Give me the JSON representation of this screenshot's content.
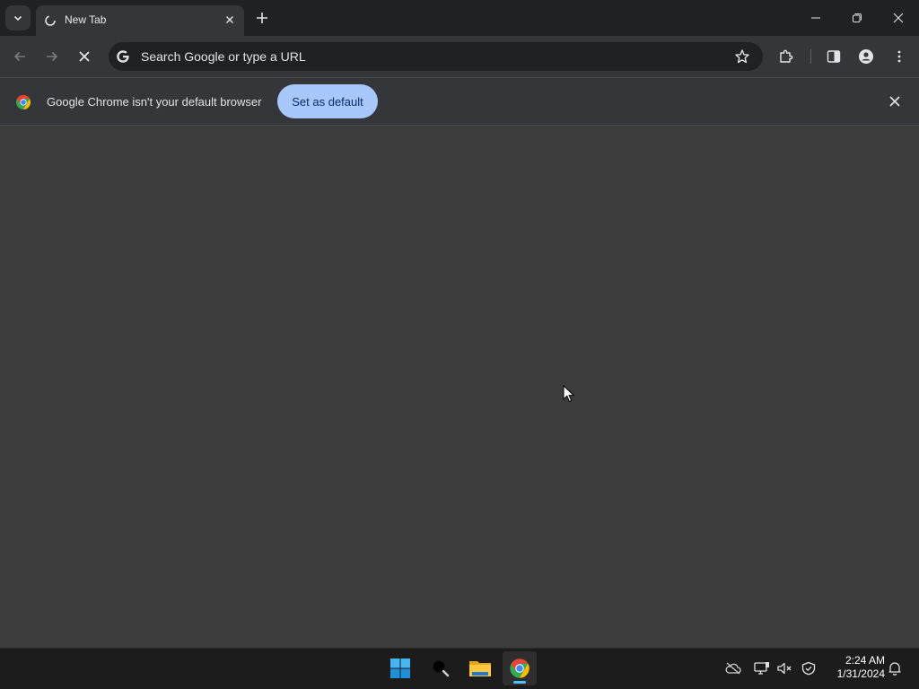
{
  "tab": {
    "title": "New Tab"
  },
  "omnibox": {
    "placeholder": "Search Google or type a URL"
  },
  "infobar": {
    "message": "Google Chrome isn't your default browser",
    "button_label": "Set as default"
  },
  "taskbar": {
    "time": "2:24 AM",
    "date": "1/31/2024"
  },
  "colors": {
    "titlebar": "#202124",
    "toolbar": "#35363a",
    "content": "#3c3c3c",
    "accent_button": "#a8c7fa",
    "taskbar": "#1c1c1c"
  },
  "icons": {
    "tab_search": "chevron-down-icon",
    "tab_favicon": "loading-icon",
    "tab_close": "close-icon",
    "new_tab": "plus-icon",
    "window_controls": [
      "minimize-icon",
      "restore-icon",
      "close-icon"
    ],
    "toolbar": [
      "back-arrow-icon",
      "forward-arrow-icon",
      "stop-icon",
      "google-g-icon",
      "bookmark-star-icon",
      "extensions-icon",
      "side-panel-icon",
      "profile-icon",
      "kebab-menu-icon"
    ],
    "taskbar": [
      "windows-start-icon",
      "search-icon",
      "file-explorer-icon",
      "chrome-icon"
    ],
    "tray": [
      "onedrive-offline-icon",
      "network-icon",
      "volume-muted-icon",
      "security-icon",
      "notification-bell-icon"
    ]
  }
}
